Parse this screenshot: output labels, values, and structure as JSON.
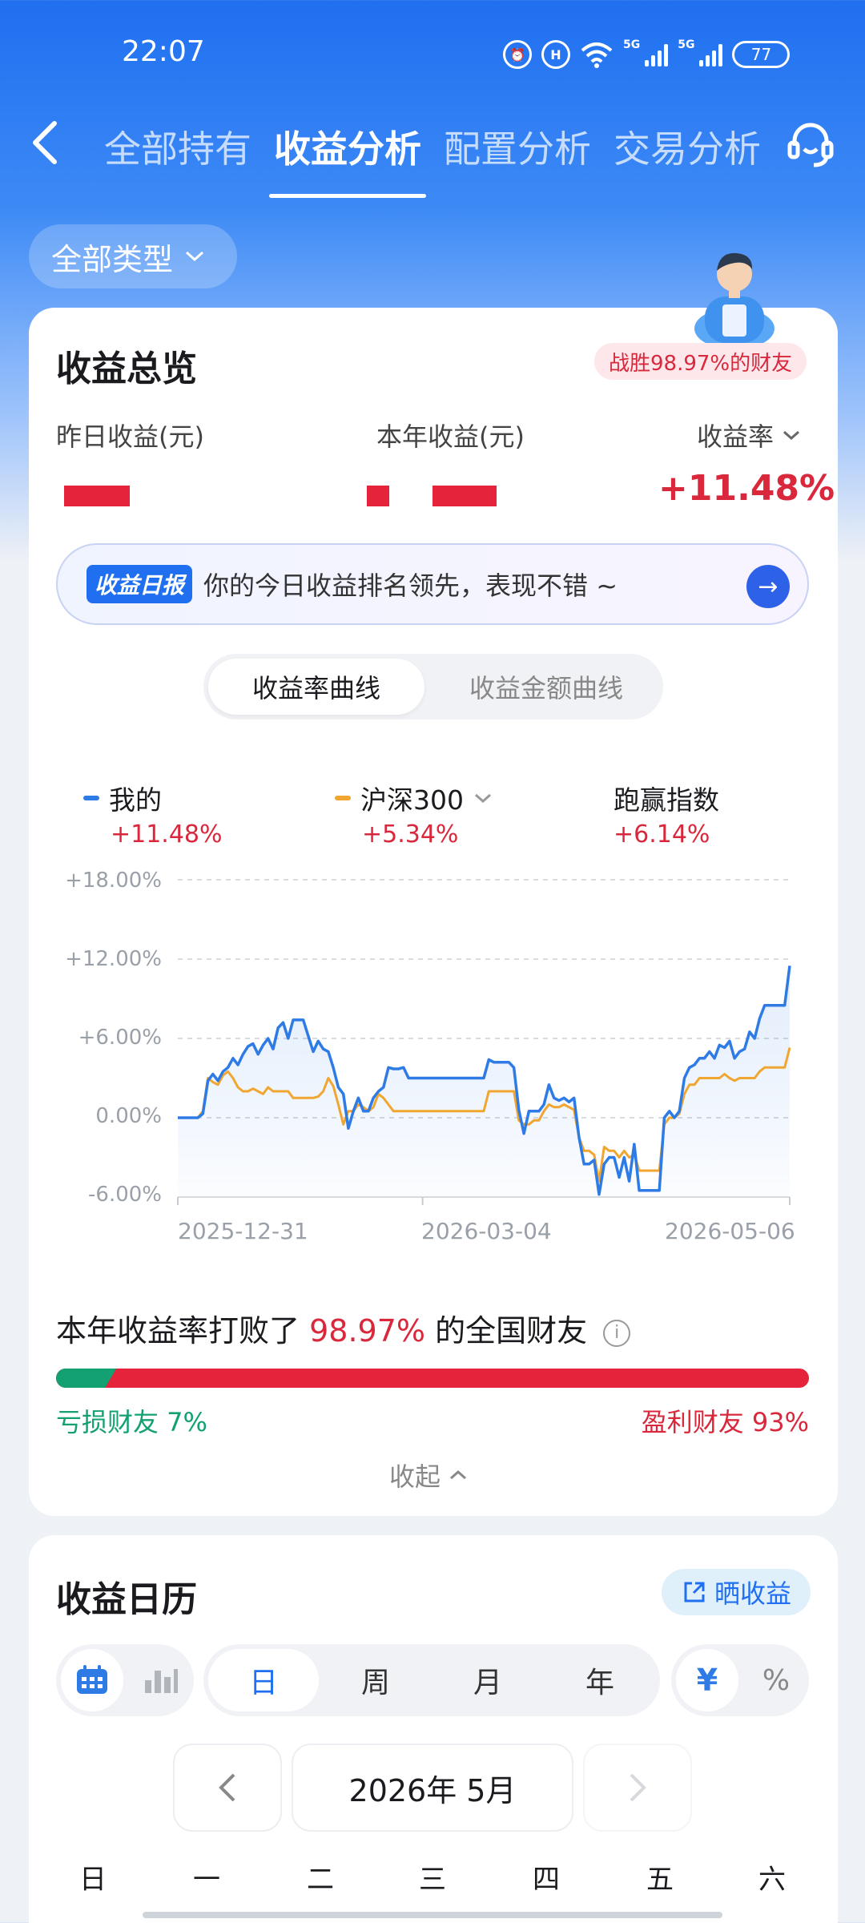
{
  "status_bar": {
    "time": "22:07",
    "signal_1": "5G",
    "signal_2": "5G",
    "battery": "77"
  },
  "nav": {
    "tabs": [
      {
        "label": "全部持有",
        "active": false
      },
      {
        "label": "收益分析",
        "active": true
      },
      {
        "label": "配置分析",
        "active": false
      },
      {
        "label": "交易分析",
        "active": false
      }
    ]
  },
  "filter": {
    "type_label": "全部类型"
  },
  "overview": {
    "title": "收益总览",
    "win_badge": "战胜98.97%的财友",
    "yesterday_label": "昨日收益(元)",
    "year_label": "本年收益(元)",
    "rate_label": "收益率",
    "rate_value": "+11.48%"
  },
  "report": {
    "tag": "收益日报",
    "text": "你的今日收益排名领先，表现不错 ~"
  },
  "curve_tabs": {
    "rate": "收益率曲线",
    "amount": "收益金额曲线"
  },
  "legend": {
    "mine": {
      "name": "我的",
      "value": "+11.48%",
      "color": "#2f7be6"
    },
    "index": {
      "name": "沪深300",
      "value": "+5.34%",
      "color": "#f0a630"
    },
    "beat": {
      "name": "跑赢指数",
      "value": "+6.14%"
    }
  },
  "chart_data": {
    "type": "line",
    "y_ticks": [
      "+18.00%",
      "+12.00%",
      "+6.00%",
      "0.00%",
      "-6.00%"
    ],
    "ylim": [
      -6,
      18
    ],
    "x_ticks": [
      "2025-12-31",
      "2026-03-04",
      "2026-05-06"
    ],
    "series": [
      {
        "name": "我的",
        "color": "#2f7be6",
        "values": [
          0,
          0,
          0,
          0,
          0,
          0.3,
          2.8,
          3.3,
          2.8,
          3.5,
          3.8,
          4.5,
          4.0,
          4.8,
          5.4,
          5.6,
          4.8,
          5.5,
          6.0,
          5.2,
          6.8,
          7.2,
          6.0,
          7.4,
          7.4,
          7.4,
          6.2,
          5.0,
          5.8,
          5.2,
          5.0,
          3.8,
          2.3,
          1.8,
          -0.8,
          0.5,
          1.5,
          0.5,
          0.5,
          1.5,
          2.0,
          2.3,
          3.8,
          3.7,
          3.7,
          3.8,
          3.0,
          3.0,
          3.0,
          3.0,
          3.0,
          3.0,
          3.0,
          3.0,
          3.0,
          3.0,
          3.0,
          3.0,
          3.0,
          3.0,
          3.0,
          3.0,
          4.4,
          4.2,
          4.2,
          4.2,
          4.2,
          3.8,
          0.6,
          -1.2,
          0.5,
          0.5,
          0.5,
          1.0,
          2.5,
          1.5,
          1.3,
          1.5,
          1.2,
          1.5,
          -1.5,
          -3.5,
          -3.5,
          -3.2,
          -5.8,
          -3.5,
          -3.0,
          -3.0,
          -4.5,
          -3.0,
          -4.8,
          -2.0,
          -5.5,
          -5.5,
          -5.5,
          -5.5,
          -5.5,
          0.0,
          0.5,
          0.0,
          0.5,
          3.0,
          3.8,
          4.0,
          4.5,
          4.5,
          5.0,
          4.5,
          5.5,
          5.3,
          5.8,
          4.5,
          5.0,
          5.2,
          6.5,
          6.0,
          7.5,
          8.5,
          8.5,
          8.5,
          8.5,
          8.5,
          11.5
        ]
      },
      {
        "name": "沪深300",
        "color": "#f0a630",
        "values": [
          0,
          0,
          0,
          0,
          0,
          0.5,
          3.0,
          2.7,
          2.5,
          3.2,
          3.5,
          3.0,
          2.3,
          2.0,
          2.0,
          2.2,
          2.0,
          1.8,
          2.3,
          2.0,
          2.0,
          2.0,
          2.0,
          1.5,
          1.5,
          1.5,
          1.5,
          1.5,
          1.6,
          2.0,
          3.0,
          2.4,
          1.0,
          -0.5,
          0.5,
          0.5,
          1.0,
          0.8,
          0.5,
          0.8,
          1.8,
          1.5,
          1.0,
          0.5,
          0.5,
          0.5,
          0.5,
          0.5,
          0.5,
          0.5,
          0.5,
          0.5,
          0.5,
          0.5,
          0.5,
          0.5,
          0.5,
          0.5,
          0.5,
          0.5,
          0.5,
          0.5,
          2.0,
          2.0,
          2.0,
          2.0,
          2.0,
          2.0,
          -0.2,
          -0.5,
          -0.5,
          -0.2,
          -0.2,
          0.5,
          1.0,
          0.8,
          0.8,
          1.0,
          0.8,
          0.6,
          -1.5,
          -2.5,
          -2.5,
          -2.8,
          -4.8,
          -2.2,
          -2.5,
          -2.5,
          -3.0,
          -2.5,
          -3.0,
          -2.8,
          -4.0,
          -4.0,
          -4.0,
          -4.0,
          -4.0,
          -0.5,
          0.0,
          0.0,
          0.3,
          1.8,
          2.5,
          2.5,
          3.0,
          3.0,
          3.0,
          3.0,
          3.0,
          3.3,
          3.0,
          2.8,
          3.0,
          3.0,
          3.0,
          3.0,
          3.5,
          3.8,
          3.8,
          3.8,
          3.8,
          3.8,
          5.3
        ]
      }
    ]
  },
  "beat": {
    "prefix": "本年收益率打败了",
    "percent": "98.97%",
    "suffix": "的全国财友",
    "loss_fraction": 0.08,
    "loss_label": "亏损财友 7%",
    "gain_label": "盈利财友 93%",
    "collapse": "收起"
  },
  "calendar": {
    "title": "收益日历",
    "share": "晒收益",
    "periods": [
      "日",
      "周",
      "月",
      "年"
    ],
    "currency": "¥",
    "percent": "%",
    "month": "2026年 5月",
    "weekdays": [
      "日",
      "一",
      "二",
      "三",
      "四",
      "五",
      "六"
    ]
  }
}
